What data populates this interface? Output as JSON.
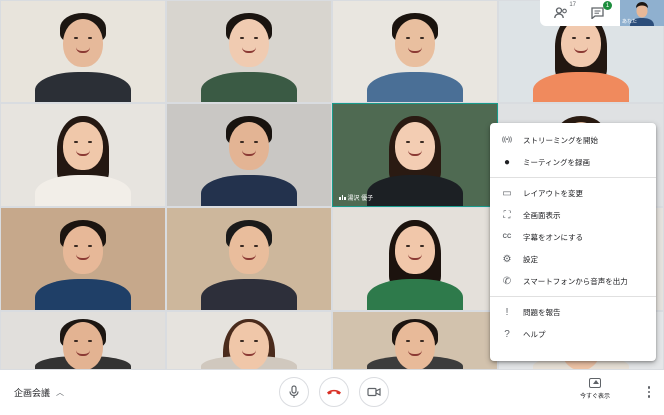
{
  "meeting": {
    "title": "企画会議"
  },
  "top_bar": {
    "participants_count": "17",
    "chat_unread": "1",
    "self_label": "あなた"
  },
  "tiles": [
    {
      "bg": "#e8e4dc",
      "skin": "#e6b99a",
      "hair": "#1c1612",
      "body": "#2b2f36",
      "long": false
    },
    {
      "bg": "#d8d5cf",
      "skin": "#f0cbb1",
      "hair": "#1a1410",
      "body": "#3a5a44",
      "long": false
    },
    {
      "bg": "#e9e6e0",
      "skin": "#e9bf9f",
      "hair": "#1a130e",
      "body": "#4a6f96",
      "long": false
    },
    {
      "bg": "#dde3e6",
      "skin": "#f1c9ae",
      "hair": "#221711",
      "body": "#f08a5d",
      "long": true
    },
    {
      "bg": "#e7e4df",
      "skin": "#f0c8aa",
      "hair": "#241812",
      "body": "#f2eee8",
      "long": true
    },
    {
      "bg": "#c9c7c4",
      "skin": "#e3b494",
      "hair": "#18130f",
      "body": "#23324d",
      "long": false
    },
    {
      "bg": "#4f6a52",
      "skin": "#f3cdb3",
      "hair": "#2a1a12",
      "body": "#1c2024",
      "long": true
    },
    {
      "bg": "#dfe1e3",
      "skin": "#e8c0a1",
      "hair": "#2a1b12",
      "body": "#2f3b46",
      "long": false
    },
    {
      "bg": "#c6a88b",
      "skin": "#e7b898",
      "hair": "#1b1410",
      "body": "#1f3f67",
      "long": false
    },
    {
      "bg": "#cdb79c",
      "skin": "#e9bd9c",
      "hair": "#1a1a1a",
      "body": "#2d2f3a",
      "long": false
    },
    {
      "bg": "#e4e0da",
      "skin": "#f1c7aa",
      "hair": "#1c130e",
      "body": "#2e7a4b",
      "long": true
    },
    {
      "bg": "#e5e2dd",
      "skin": "#e6b595",
      "hair": "#1b1410",
      "body": "#7a9bc0",
      "long": false
    },
    {
      "bg": "#e1dfdc",
      "skin": "#e3b392",
      "hair": "#1c1612",
      "body": "#333",
      "long": false
    },
    {
      "bg": "#e6e3de",
      "skin": "#f0c7a9",
      "hair": "#4a2b1c",
      "body": "#d0c8be",
      "long": true
    },
    {
      "bg": "#d2c2ad",
      "skin": "#e8ba99",
      "hair": "#1c1410",
      "body": "#3c3c3c",
      "long": false
    },
    {
      "bg": "#e4e6e8",
      "skin": "#eec3a6",
      "hair": "#2a1c14",
      "body": "#e7e0d6",
      "long": true
    }
  ],
  "speaking_tile": {
    "name": "湯沢 優子"
  },
  "menu": {
    "items": [
      {
        "icon": "broadcast-icon",
        "glyph": "((•))",
        "label": "ストリーミングを開始"
      },
      {
        "icon": "record-icon",
        "glyph": "●",
        "label": "ミーティングを録画"
      },
      {
        "icon": "layout-icon",
        "glyph": "▭",
        "label": "レイアウトを変更"
      },
      {
        "icon": "fullscreen-icon",
        "glyph": "⛶",
        "label": "全画面表示"
      },
      {
        "icon": "captions-icon",
        "glyph": "CC",
        "label": "字幕をオンにする"
      },
      {
        "icon": "gear-icon",
        "glyph": "⚙",
        "label": "設定"
      },
      {
        "icon": "phone-audio-icon",
        "glyph": "✆",
        "label": "スマートフォンから音声を出力"
      },
      {
        "icon": "report-icon",
        "glyph": "!",
        "label": "問題を報告"
      },
      {
        "icon": "help-icon",
        "glyph": "?",
        "label": "ヘルプ"
      }
    ]
  },
  "bottom_bar": {
    "present_label": "今すぐ表示"
  },
  "colors": {
    "end_call": "#d93025",
    "speaking_outline": "#1a9c8c",
    "badge": "#1e8e3e"
  }
}
